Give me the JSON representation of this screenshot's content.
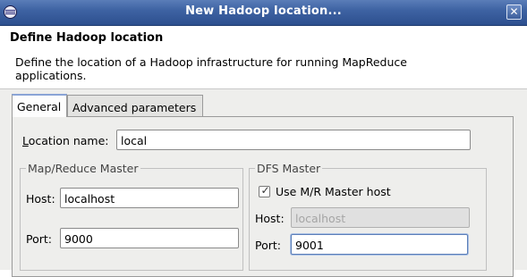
{
  "window": {
    "title": "New Hadoop location...",
    "close_glyph": "✕",
    "icon": "eclipse-icon"
  },
  "header": {
    "title": "Define Hadoop location",
    "description": "Define the location of a Hadoop infrastructure for running MapReduce applications."
  },
  "tabs": [
    {
      "label": "General",
      "selected": true
    },
    {
      "label": "Advanced parameters",
      "selected": false
    }
  ],
  "general": {
    "location_name": {
      "label_accel": "L",
      "label_rest": "ocation name:",
      "value": "local"
    },
    "mapreduce_master": {
      "title": "Map/Reduce Master",
      "host_label": "Host:",
      "host_value": "localhost",
      "port_label": "Port:",
      "port_value": "9000"
    },
    "dfs_master": {
      "title": "DFS Master",
      "use_mr_host_label": "Use M/R Master host",
      "use_mr_host_checked": true,
      "check_glyph": "✓",
      "host_label": "Host:",
      "host_value": "localhost",
      "port_label": "Port:",
      "port_value": "9001"
    }
  },
  "colors": {
    "titlebar": "#3e63a3",
    "content_bg": "#eeeeec",
    "focus_border": "#5c7fb8"
  }
}
